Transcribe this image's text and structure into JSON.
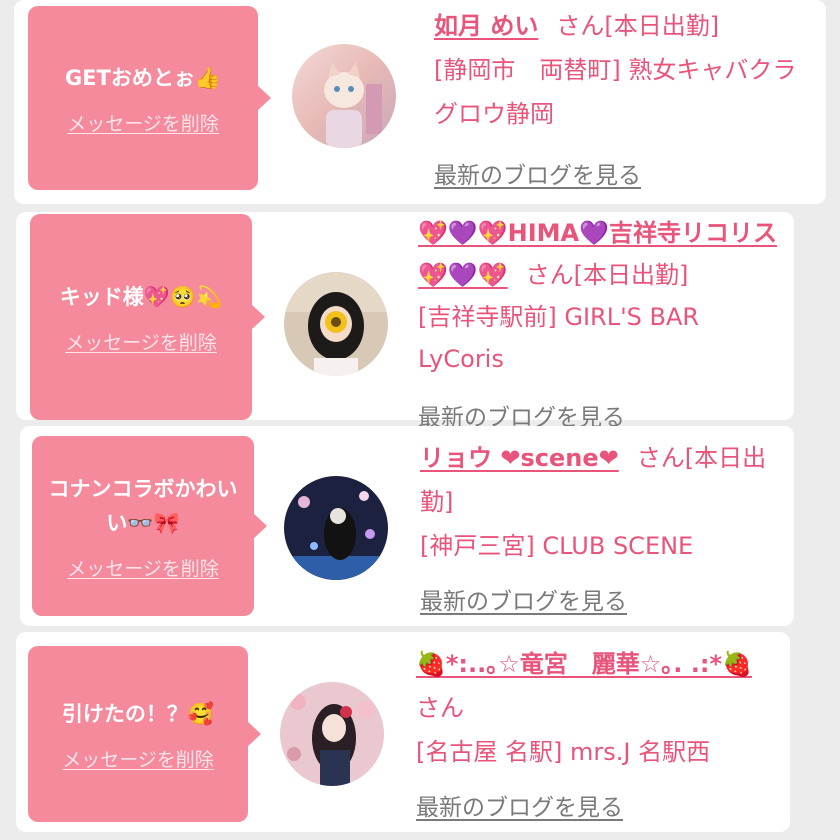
{
  "entries": [
    {
      "message": "GETおめとぉ👍",
      "delete_label": "メッセージを削除",
      "name": "如月 めい",
      "status": "さん[本日出勤]",
      "shop": "[静岡市　両替町] 熟女キャバクラ グロウ静岡",
      "blog_label": "最新のブログを見る"
    },
    {
      "message": "キッド様💖🥺💫",
      "delete_label": "メッセージを削除",
      "name": "💖💜💖HIMA💜吉祥寺リコリス💖💜💖",
      "status": "さん[本日出勤]",
      "shop": "[吉祥寺駅前] GIRL'S BAR LyCoris",
      "blog_label": "最新のブログを見る"
    },
    {
      "message": "コナンコラボかわいい👓🎀",
      "delete_label": "メッセージを削除",
      "name": "リョウ ❤scene❤",
      "status": "さん[本日出勤]",
      "shop": "[神戸三宮] CLUB SCENE",
      "blog_label": "最新のブログを見る"
    },
    {
      "message": "引けたの！？🥰",
      "delete_label": "メッセージを削除",
      "name": "🍓*:..｡☆竜宮　麗華☆｡. .:*🍓",
      "status": "さん",
      "shop": "[名古屋 名駅] mrs.J 名駅西",
      "blog_label": "最新のブログを見る"
    }
  ],
  "colors": {
    "bubble": "#f48a9c",
    "accent_text": "#e8547a",
    "link_gray": "#7a7a7a",
    "background": "#ececec",
    "card": "#ffffff"
  }
}
